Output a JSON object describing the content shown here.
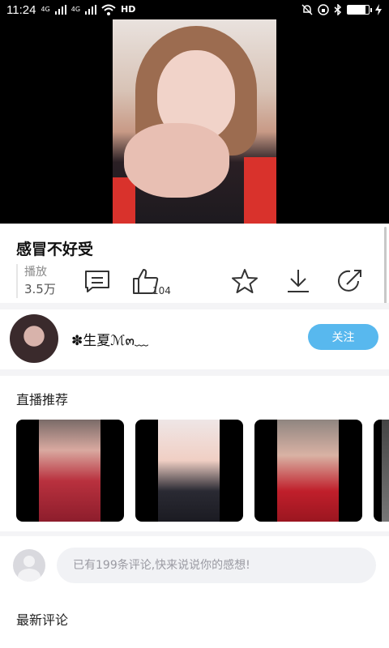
{
  "status_bar": {
    "time": "11:24",
    "signal_1_label": "4G",
    "signal_2_label": "4G",
    "hd_label": "HD",
    "battery_level": 0.85
  },
  "video": {
    "title": "感冒不好受"
  },
  "stats": {
    "play_label": "播放",
    "play_count": "3.5万",
    "like_count": "104",
    "icons": [
      "comment-icon",
      "like-icon",
      "star-icon",
      "download-icon",
      "share-icon"
    ]
  },
  "author": {
    "name": "✽生夏ℳ๓﹏",
    "follow_label": "关注"
  },
  "live": {
    "section_title": "直播推荐"
  },
  "comments": {
    "input_placeholder": "已有199条评论,快来说说你的感想!",
    "section_title": "最新评论"
  },
  "colors": {
    "accent": "#58b8ee",
    "input_bg": "#f1f2f5"
  }
}
